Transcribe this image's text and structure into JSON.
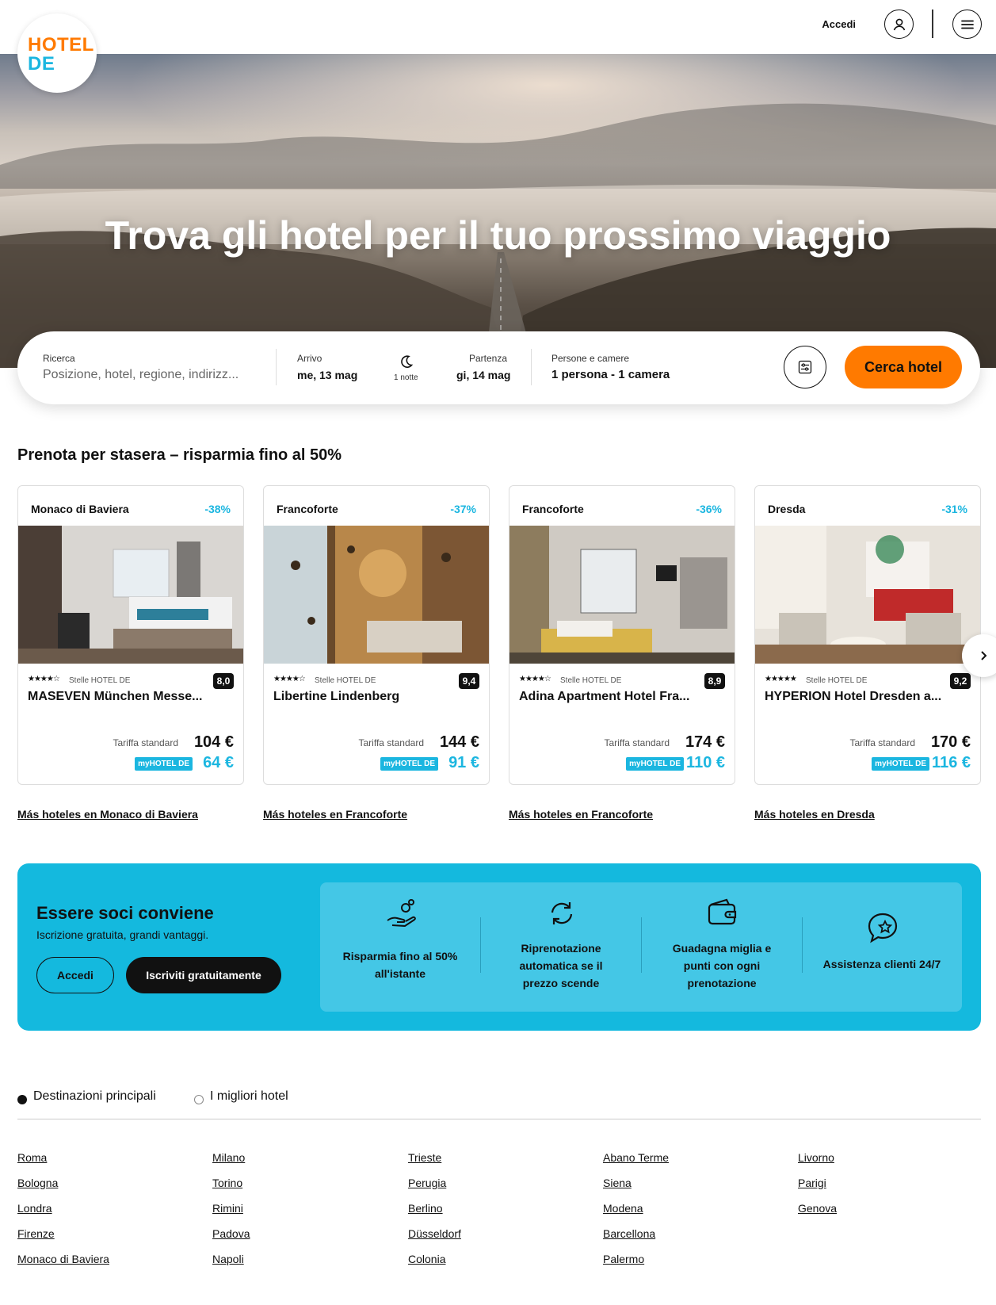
{
  "header": {
    "logo_line1": "HOTEL",
    "logo_line2": "DE",
    "login_label": "Accedi"
  },
  "hero": {
    "title": "Trova gli hotel per il tuo prossimo viaggio"
  },
  "search": {
    "search_label": "Ricerca",
    "search_placeholder": "Posizione, hotel, regione, indirizz...",
    "checkin_label": "Arrivo",
    "checkin_value": "me, 13 mag",
    "nights_label": "1 notte",
    "checkout_label": "Partenza",
    "checkout_value": "gi, 14 mag",
    "guests_label": "Persone e camere",
    "guests_value": "1 persona - 1 camera",
    "submit_label": "Cerca hotel"
  },
  "deals": {
    "title": "Prenota per stasera – risparmia fino al 50%",
    "std_label": "Tariffa standard",
    "my_badge": "myHOTEL DE",
    "star_label": "Stelle HOTEL DE",
    "cards": [
      {
        "city": "Monaco di Baviera",
        "discount": "-38%",
        "stars": "★★★★☆",
        "score": "8,0",
        "name": "MASEVEN München Messe...",
        "std_price": "104 €",
        "my_price": "64 €",
        "more": "Más hoteles en Monaco di Baviera"
      },
      {
        "city": "Francoforte",
        "discount": "-37%",
        "stars": "★★★★☆",
        "score": "9,4",
        "name": "Libertine Lindenberg",
        "std_price": "144 €",
        "my_price": "91 €",
        "more": "Más hoteles en Francoforte"
      },
      {
        "city": "Francoforte",
        "discount": "-36%",
        "stars": "★★★★☆",
        "score": "8,9",
        "name": "Adina Apartment Hotel Fra...",
        "std_price": "174 €",
        "my_price": "110 €",
        "more": "Más hoteles en Francoforte"
      },
      {
        "city": "Dresda",
        "discount": "-31%",
        "stars": "★★★★★",
        "score": "9,2",
        "name": "HYPERION Hotel Dresden a...",
        "std_price": "170 €",
        "my_price": "116 €",
        "more": "Más hoteles en Dresda"
      }
    ]
  },
  "membership": {
    "title": "Essere soci conviene",
    "subtitle": "Iscrizione gratuita, grandi vantaggi.",
    "login_label": "Accedi",
    "join_label": "Iscriviti gratuitamente",
    "benefits": [
      {
        "icon": "savings-hand-icon",
        "line1": "Risparmia fino al 50%",
        "line2": "all'istante",
        "line3": ""
      },
      {
        "icon": "refresh-icon",
        "line1": "Riprenotazione",
        "line2": "automatica se il",
        "line3": "prezzo scende"
      },
      {
        "icon": "wallet-icon",
        "line1": "Guadagna miglia e",
        "line2": "punti con ogni",
        "line3": "prenotazione"
      },
      {
        "icon": "support-chat-star-icon",
        "line1": "Assistenza clienti 24/7",
        "line2": "",
        "line3": ""
      }
    ]
  },
  "destinations": {
    "tab_active": "Destinazioni principali",
    "tab_inactive": "I migliori hotel",
    "columns": [
      [
        "Roma",
        "Bologna",
        "Londra",
        "Firenze",
        "Monaco di Baviera"
      ],
      [
        "Milano",
        "Torino",
        "Rimini",
        "Padova",
        "Napoli"
      ],
      [
        "Trieste",
        "Perugia",
        "Berlino",
        "Düsseldorf",
        "Colonia"
      ],
      [
        "Abano Terme",
        "Siena",
        "Modena",
        "Barcellona",
        "Palermo"
      ],
      [
        "Livorno",
        "Parigi",
        "Genova"
      ]
    ]
  },
  "colors": {
    "brand_orange": "#ff7a00",
    "brand_blue": "#1bb6e0"
  }
}
